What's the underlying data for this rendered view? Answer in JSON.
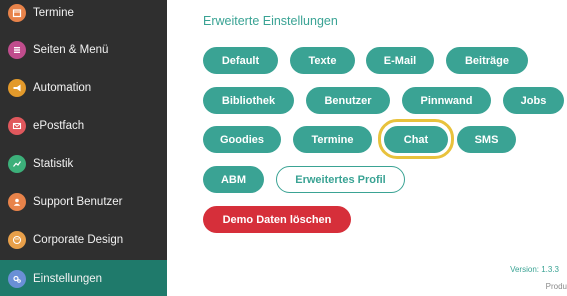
{
  "sidebar": {
    "items": [
      {
        "label": "Termine",
        "icon": "calendar-icon",
        "color": "#e8834a"
      },
      {
        "label": "Seiten & Menü",
        "icon": "pages-icon",
        "color": "#c04d8d"
      },
      {
        "label": "Automation",
        "icon": "megaphone-icon",
        "color": "#e39a2b"
      },
      {
        "label": "ePostfach",
        "icon": "mail-icon",
        "color": "#e0585d"
      },
      {
        "label": "Statistik",
        "icon": "chart-icon",
        "color": "#3cb07a"
      },
      {
        "label": "Support Benutzer",
        "icon": "user-icon",
        "color": "#e8834a"
      },
      {
        "label": "Corporate Design",
        "icon": "palette-icon",
        "color": "#e8a04a"
      },
      {
        "label": "Einstellungen",
        "icon": "gears-icon",
        "color": "#6a8fd6"
      }
    ],
    "active_index": 7
  },
  "main": {
    "section_title": "Erweiterte Einstellungen",
    "buttons": {
      "default": "Default",
      "texte": "Texte",
      "email": "E-Mail",
      "beitraege": "Beiträge",
      "bibliothek": "Bibliothek",
      "benutzer": "Benutzer",
      "pinnwand": "Pinnwand",
      "jobs": "Jobs",
      "goodies": "Goodies",
      "termine": "Termine",
      "chat": "Chat",
      "sms": "SMS",
      "abm": "ABM",
      "erweitertes_profil": "Erweitertes Profil",
      "demo_loeschen": "Demo Daten löschen"
    },
    "version": "Version: 1.3.3",
    "footer_fragment": "Produ"
  },
  "colors": {
    "accent": "#3aa394",
    "danger": "#d62f3a",
    "highlight": "#e8c23c",
    "sidebar_bg": "#2f2f2f",
    "sidebar_active": "#1f7a6b"
  }
}
